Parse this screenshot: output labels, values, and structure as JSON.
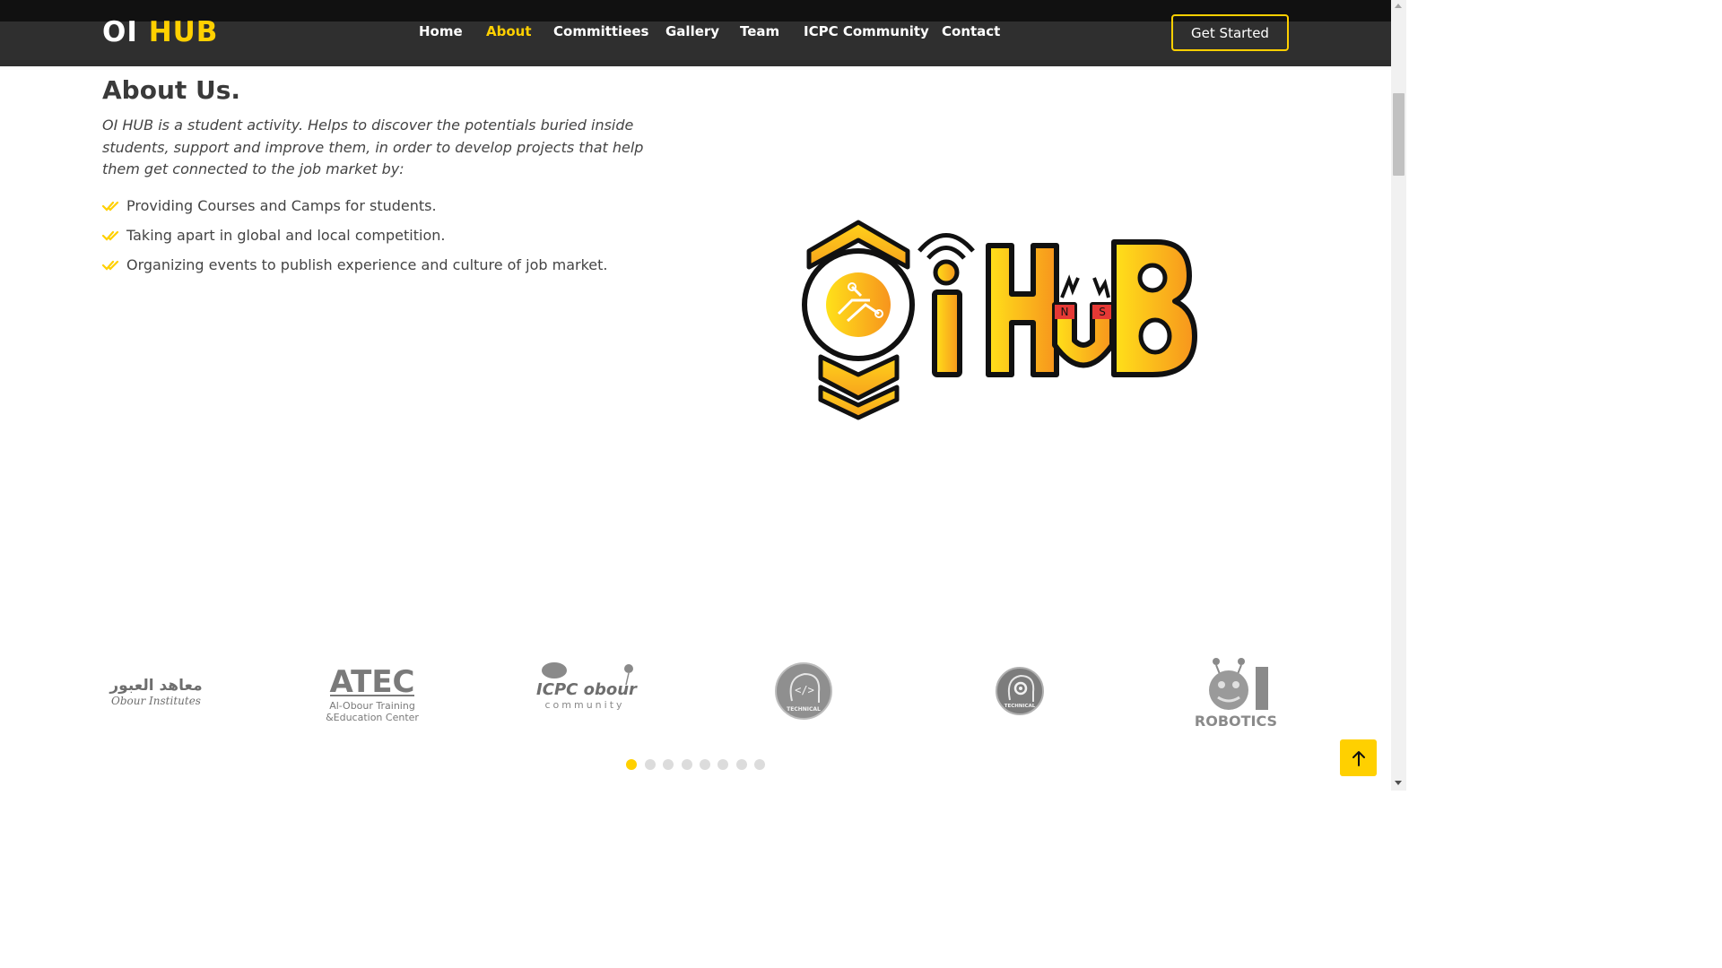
{
  "header": {
    "logo_main": "OI",
    "logo_accent": "HUB",
    "nav": [
      {
        "label": "Home",
        "active": false
      },
      {
        "label": "About",
        "active": true
      },
      {
        "label": "Committiees",
        "active": false
      },
      {
        "label": "Gallery",
        "active": false
      },
      {
        "label": "Team",
        "active": false
      },
      {
        "label": "ICPC Community",
        "active": false
      },
      {
        "label": "Contact",
        "active": false
      }
    ],
    "cta_label": "Get Started"
  },
  "about": {
    "title": "About Us.",
    "description": "OI HUB is a student activity. Helps to discover the potentials buried inside students, support and improve them, in order to develop projects that help them get connected to the job market by:",
    "items": [
      "Providing Courses and Camps for students.",
      "Taking apart in global and local competition.",
      "Organizing events to publish experience and culture of job market."
    ],
    "check_icon": "double-check-icon"
  },
  "hero_logo": {
    "text_i": "i",
    "text_hub": "HUB",
    "magnet_n": "N",
    "magnet_s": "S"
  },
  "clients": [
    {
      "name": "obour-institutes-logo",
      "ar": "معاهد العبور",
      "en": "Obour Institutes"
    },
    {
      "name": "atec-logo",
      "line1": "ATEC",
      "line2": "Al-Obour Training",
      "line3": "&Education Center"
    },
    {
      "name": "icpc-obour-logo",
      "line1": "ICPC obour",
      "line2": "community"
    },
    {
      "name": "technical-logo-1",
      "label": "TECHNICAL"
    },
    {
      "name": "technical-logo-2",
      "label": "TECHNICAL"
    },
    {
      "name": "robotics-logo",
      "label": "ROBOTICS"
    }
  ],
  "carousel": {
    "pages": 8,
    "active_index": 0
  },
  "colors": {
    "accent": "#ffd000",
    "header_bg": "#2f2f2f",
    "text": "#444444"
  }
}
